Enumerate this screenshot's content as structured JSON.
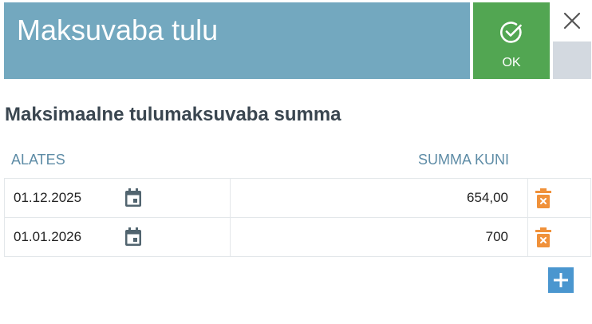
{
  "header": {
    "title": "Maksuvaba tulu",
    "ok_label": "OK"
  },
  "section": {
    "title": "Maksimaalne tulumaksuvaba summa"
  },
  "table": {
    "columns": [
      "ALATES",
      "SUMMA KUNI"
    ],
    "rows": [
      {
        "date": "01.12.2025",
        "amount": "654,00"
      },
      {
        "date": "01.01.2026",
        "amount": "700"
      }
    ]
  },
  "icons": {
    "ok": "check-circle-icon",
    "close": "close-icon",
    "calendar": "calendar-icon",
    "delete": "trash-icon",
    "add": "plus-icon"
  },
  "colors": {
    "header_bg": "#73a8bf",
    "ok_bg": "#52a652",
    "delete_icon": "#f0913a",
    "add_button": "#4a96cf",
    "column_header": "#5e8ca6"
  }
}
